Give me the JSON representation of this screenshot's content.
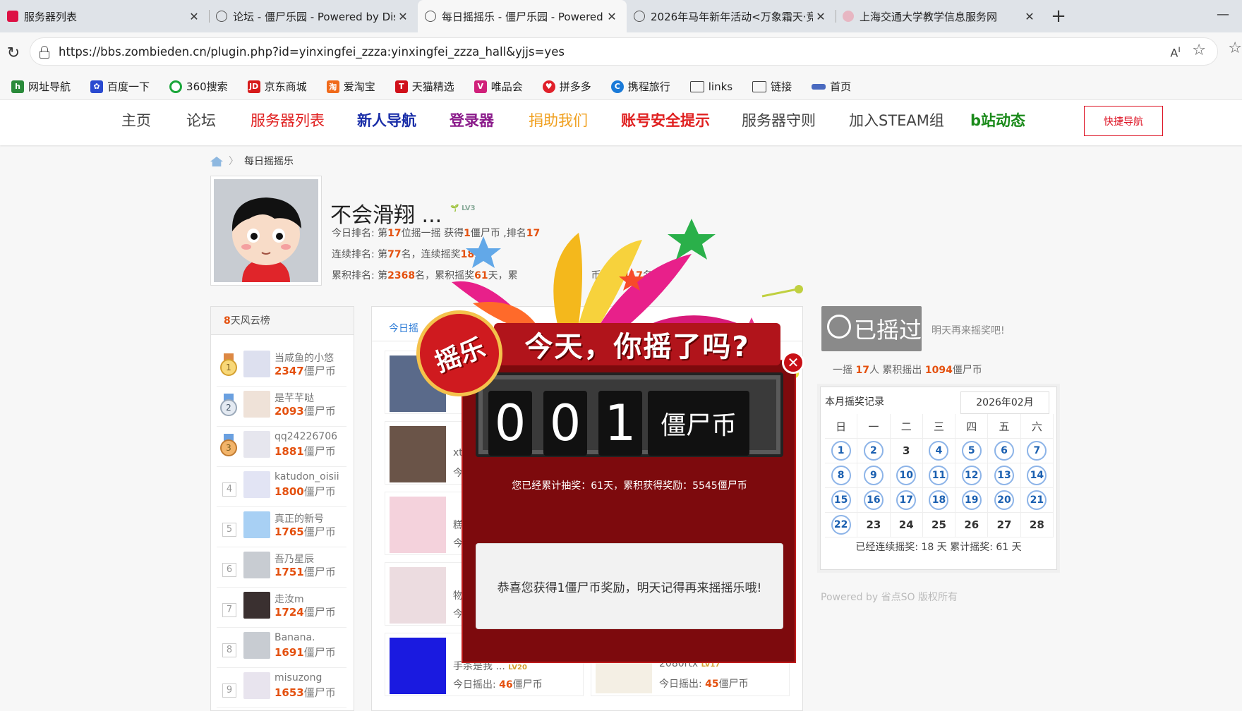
{
  "browser": {
    "tabs": [
      {
        "title": "服务器列表"
      },
      {
        "title": "论坛 - 僵尸乐园 - Powered by Disc"
      },
      {
        "title": "每日摇摇乐 - 僵尸乐园 - Powered"
      },
      {
        "title": "2026年马年新年活动<万象霜天·竞"
      },
      {
        "title": "上海交通大学教学信息服务网"
      }
    ],
    "url": "https://bbs.zombieden.cn/plugin.php?id=yinxingfei_zzza:yinxingfei_zzza_hall&yjjs=yes",
    "bookmarks": [
      "网址导航",
      "百度一下",
      "360搜索",
      "京东商城",
      "爱淘宝",
      "天猫精选",
      "唯品会",
      "拼多多",
      "携程旅行",
      "links",
      "链接",
      "首页"
    ]
  },
  "nav": {
    "items": [
      {
        "label": "主页",
        "color": "#444444"
      },
      {
        "label": "论坛",
        "color": "#444444"
      },
      {
        "label": "服务器列表",
        "color": "#e02020"
      },
      {
        "label": "新人导航",
        "color": "#1a2ea8"
      },
      {
        "label": "登录器",
        "color": "#8a1a8a"
      },
      {
        "label": "捐助我们",
        "color": "#f0a020"
      },
      {
        "label": "账号安全提示",
        "color": "#e02020"
      },
      {
        "label": "服务器守则",
        "color": "#444444"
      },
      {
        "label": "加入STEAM组",
        "color": "#444444"
      },
      {
        "label": "b站动态",
        "color": "#1a8a1a"
      }
    ],
    "quick": "快捷导航"
  },
  "breadcrumb": "每日摇摇乐",
  "user": {
    "name": "不会滑翔 ...",
    "level": "LV3",
    "today_a": "今日排名: 第",
    "today_rank": "17",
    "today_b": "位摇一摇 获得",
    "today_coin": "1",
    "today_c": "僵尸币 ,排名",
    "today_pos": "17",
    "cont_a": "连续排名: 第",
    "cont_rank": "77",
    "cont_b": "名，连续摇奖",
    "cont_days": "18",
    "cont_c": "天",
    "total_a": "累积排名: 第",
    "total_rank": "2368",
    "total_b": "名，累积摇奖",
    "total_days": "61",
    "total_c": "天，累",
    "total_d": "币",
    "total_e": "第",
    "total_pos": "417",
    "total_f": "名"
  },
  "leaderboard": {
    "title_num": "8",
    "title": "天风云榜",
    "unit": "僵尸币",
    "rows": [
      {
        "rank": "1",
        "name": "当咸鱼的小悠",
        "coins": "2347"
      },
      {
        "rank": "2",
        "name": "是芊芊哒",
        "coins": "2093"
      },
      {
        "rank": "3",
        "name": "qq24226706",
        "coins": "1881"
      },
      {
        "rank": "4",
        "name": "katudon_oisii",
        "coins": "1800"
      },
      {
        "rank": "5",
        "name": "真正的新号",
        "coins": "1765"
      },
      {
        "rank": "6",
        "name": "吾乃星辰",
        "coins": "1751"
      },
      {
        "rank": "7",
        "name": "走汝m",
        "coins": "1724"
      },
      {
        "rank": "8",
        "name": "Banana.",
        "coins": "1691"
      },
      {
        "rank": "9",
        "name": "misuzong",
        "coins": "1653"
      }
    ]
  },
  "middle": {
    "tab": "今日摇",
    "cards": [
      {
        "name": "",
        "coin_label": "",
        "coin": ""
      },
      {
        "name": "xt",
        "coin_label": "今",
        "coin": ""
      },
      {
        "name": "糕",
        "coin_label": "今",
        "coin": ""
      },
      {
        "name": "物",
        "coin_label": "今",
        "coin": ""
      },
      {
        "name": "手杀是我 ...",
        "coin_label": "今日摇出:",
        "coin": "46",
        "unit": "僵尸币",
        "level": "LV20"
      },
      {
        "name": "2080rtx",
        "coin_label": "今日摇出:",
        "coin": "45",
        "unit": "僵尸币",
        "level": "LV17"
      }
    ]
  },
  "right": {
    "shaken": "已摇过",
    "tomorrow": "明天再来摇奖吧!",
    "stat_a": "一摇",
    "stat_people": "17",
    "stat_b": "人 累积摇出",
    "stat_total": "1094",
    "stat_c": "僵尸币",
    "cal_title": "本月摇奖记录",
    "cal_month": "2026年02月",
    "weekdays": [
      "日",
      "一",
      "二",
      "三",
      "四",
      "五",
      "六"
    ],
    "days": [
      [
        {
          "d": "1",
          "s": true
        },
        {
          "d": "2",
          "s": true
        },
        {
          "d": "3",
          "s": false
        },
        {
          "d": "4",
          "s": true
        },
        {
          "d": "5",
          "s": true
        },
        {
          "d": "6",
          "s": true
        },
        {
          "d": "7",
          "s": true
        }
      ],
      [
        {
          "d": "8",
          "s": true
        },
        {
          "d": "9",
          "s": true
        },
        {
          "d": "10",
          "s": true
        },
        {
          "d": "11",
          "s": true
        },
        {
          "d": "12",
          "s": true
        },
        {
          "d": "13",
          "s": true
        },
        {
          "d": "14",
          "s": true
        }
      ],
      [
        {
          "d": "15",
          "s": true
        },
        {
          "d": "16",
          "s": true
        },
        {
          "d": "17",
          "s": true
        },
        {
          "d": "18",
          "s": true
        },
        {
          "d": "19",
          "s": true
        },
        {
          "d": "20",
          "s": true
        },
        {
          "d": "21",
          "s": true
        }
      ],
      [
        {
          "d": "22",
          "s": true
        },
        {
          "d": "23",
          "s": false
        },
        {
          "d": "24",
          "s": false
        },
        {
          "d": "25",
          "s": false
        },
        {
          "d": "26",
          "s": false
        },
        {
          "d": "27",
          "s": false
        },
        {
          "d": "28",
          "s": false
        }
      ]
    ],
    "cal_summary": "已经连续摇奖:  18 天 累计摇奖:  61 天",
    "powered": "Powered by 省点SO 版权所有"
  },
  "popup": {
    "badge": "摇乐",
    "badge_top": "摇",
    "banner": "今天，你摇了吗?",
    "digits": [
      "0",
      "0",
      "1"
    ],
    "unit": "僵尸币",
    "summary": "您已经累计抽奖：61天，累积获得奖励：5545僵尸币",
    "message": "恭喜您获得1僵尸币奖励，明天记得再来摇摇乐哦!"
  }
}
